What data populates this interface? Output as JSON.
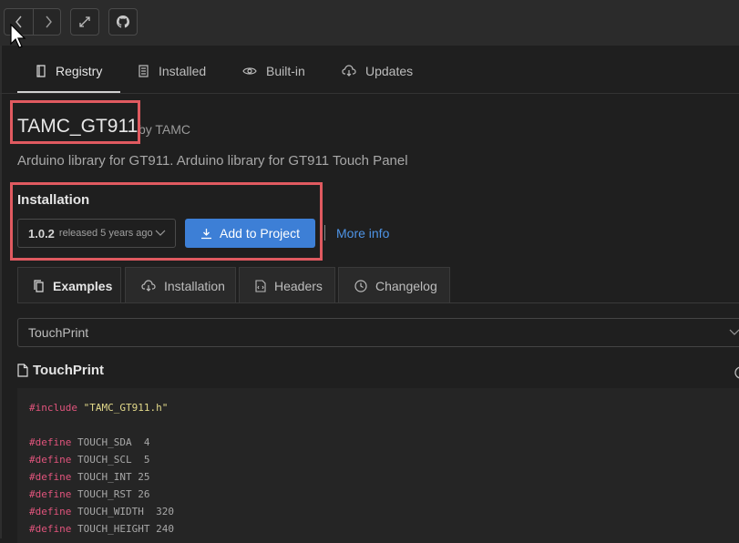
{
  "toolbar": {
    "back_icon": "chevron-left-icon",
    "forward_icon": "chevron-right-icon",
    "expand_icon": "expand-icon",
    "github_icon": "github-icon"
  },
  "tabs": [
    {
      "label": "Registry",
      "icon": "book-icon",
      "active": true
    },
    {
      "label": "Installed",
      "icon": "library-icon"
    },
    {
      "label": "Built-in",
      "icon": "eye-icon"
    },
    {
      "label": "Updates",
      "icon": "cloud-download-icon"
    }
  ],
  "package": {
    "name": "TAMC_GT911",
    "author": "by TAMC",
    "description": "Arduino library for GT911. Arduino library for GT911 Touch Panel"
  },
  "installation": {
    "heading": "Installation",
    "version": "1.0.2",
    "released": "released 5 years ago",
    "add_button": "Add to Project",
    "separator": "|",
    "more_info": "More info"
  },
  "section_tabs": [
    {
      "label": "Examples",
      "icon": "copy-icon",
      "active": true
    },
    {
      "label": "Installation",
      "icon": "cloud-download-icon"
    },
    {
      "label": "Headers",
      "icon": "file-code-icon"
    },
    {
      "label": "Changelog",
      "icon": "clock-icon"
    }
  ],
  "example": {
    "selected": "TouchPrint",
    "file_title": "TouchPrint"
  },
  "code": [
    {
      "kw": "#include",
      "rest": " ",
      "str": "\"TAMC_GT911.h\""
    },
    {
      "kw": "",
      "rest": "",
      "str": ""
    },
    {
      "kw": "#define",
      "rest": " TOUCH_SDA  4",
      "str": ""
    },
    {
      "kw": "#define",
      "rest": " TOUCH_SCL  5",
      "str": ""
    },
    {
      "kw": "#define",
      "rest": " TOUCH_INT 25",
      "str": ""
    },
    {
      "kw": "#define",
      "rest": " TOUCH_RST 26",
      "str": ""
    },
    {
      "kw": "#define",
      "rest": " TOUCH_WIDTH  320",
      "str": ""
    },
    {
      "kw": "#define",
      "rest": " TOUCH_HEIGHT 240",
      "str": ""
    }
  ],
  "colors": {
    "accent": "#3d7fd6",
    "link": "#4e94e6",
    "highlight_box": "#e05a60",
    "keyword": "#e0547c",
    "string": "#e2d98a"
  }
}
